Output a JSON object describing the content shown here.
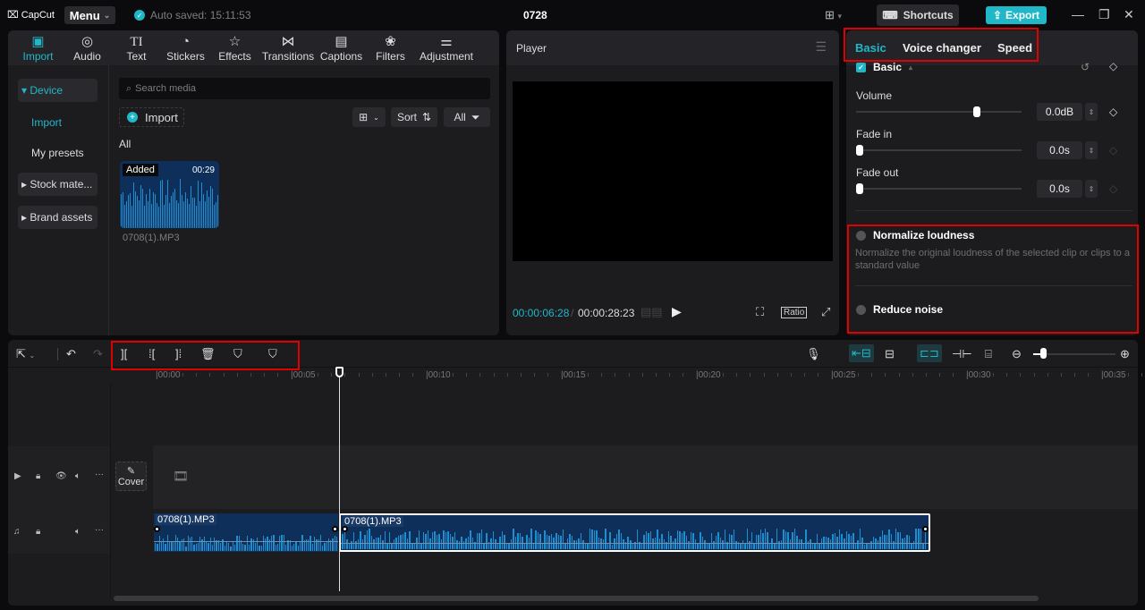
{
  "app": {
    "logo": "CapCut",
    "menu_label": "Menu",
    "autosave": "Auto saved: 15:11:53",
    "project_title": "0728",
    "shortcuts_label": "Shortcuts",
    "export_label": "Export",
    "accent_color": "#20b8c8",
    "highlight_color": "#e00000"
  },
  "media_tabs": [
    {
      "label": "Import",
      "icon": "import-icon",
      "glyph": "▣",
      "active": true
    },
    {
      "label": "Audio",
      "icon": "audio-icon",
      "glyph": "◎"
    },
    {
      "label": "Text",
      "icon": "text-icon",
      "glyph": "TI"
    },
    {
      "label": "Stickers",
      "icon": "stickers-icon",
      "glyph": "◔"
    },
    {
      "label": "Effects",
      "icon": "effects-icon",
      "glyph": "☆"
    },
    {
      "label": "Transitions",
      "icon": "transitions-icon",
      "glyph": "⋈"
    },
    {
      "label": "Captions",
      "icon": "captions-icon",
      "glyph": "▤"
    },
    {
      "label": "Filters",
      "icon": "filters-icon",
      "glyph": "❀"
    },
    {
      "label": "Adjustment",
      "icon": "adjustment-icon",
      "glyph": "⚌"
    }
  ],
  "sidebar": {
    "device": "▾ Device",
    "import": "Import",
    "presets": "My presets",
    "stock": "▸ Stock mate...",
    "brand": "▸ Brand assets"
  },
  "media": {
    "search_placeholder": "Search media",
    "import_label": "Import",
    "sort_label": "Sort",
    "filter_label": "All",
    "section_label": "All",
    "item": {
      "badge": "Added",
      "duration": "00:29",
      "filename": "0708(1).MP3"
    }
  },
  "player": {
    "title": "Player",
    "current_time": "00:00:06:28",
    "total_time": "00:00:28:23",
    "ratio_label": "Ratio"
  },
  "props": {
    "tabs": [
      "Basic",
      "Voice changer",
      "Speed"
    ],
    "active_tab": "Basic",
    "section": "Basic",
    "volume": {
      "label": "Volume",
      "value": "0.0dB",
      "slider_fraction": 0.74
    },
    "fade_in": {
      "label": "Fade in",
      "value": "0.0s",
      "slider_fraction": 0.0
    },
    "fade_out": {
      "label": "Fade out",
      "value": "0.0s",
      "slider_fraction": 0.0
    },
    "normalize": {
      "label": "Normalize loudness",
      "description": "Normalize the original loudness of the selected clip or clips to a standard value",
      "checked": false
    },
    "reduce_noise": {
      "label": "Reduce noise",
      "checked": false
    }
  },
  "timeline": {
    "ruler": [
      "00:00",
      "00:05",
      "00:10",
      "00:15",
      "00:20",
      "00:25",
      "00:30",
      "00:35"
    ],
    "cover_label": "Cover",
    "clips": [
      {
        "label": "0708(1).MP3",
        "selected": false
      },
      {
        "label": "0708(1).MP3",
        "selected": true
      }
    ],
    "zoom_fraction": 0.1
  }
}
